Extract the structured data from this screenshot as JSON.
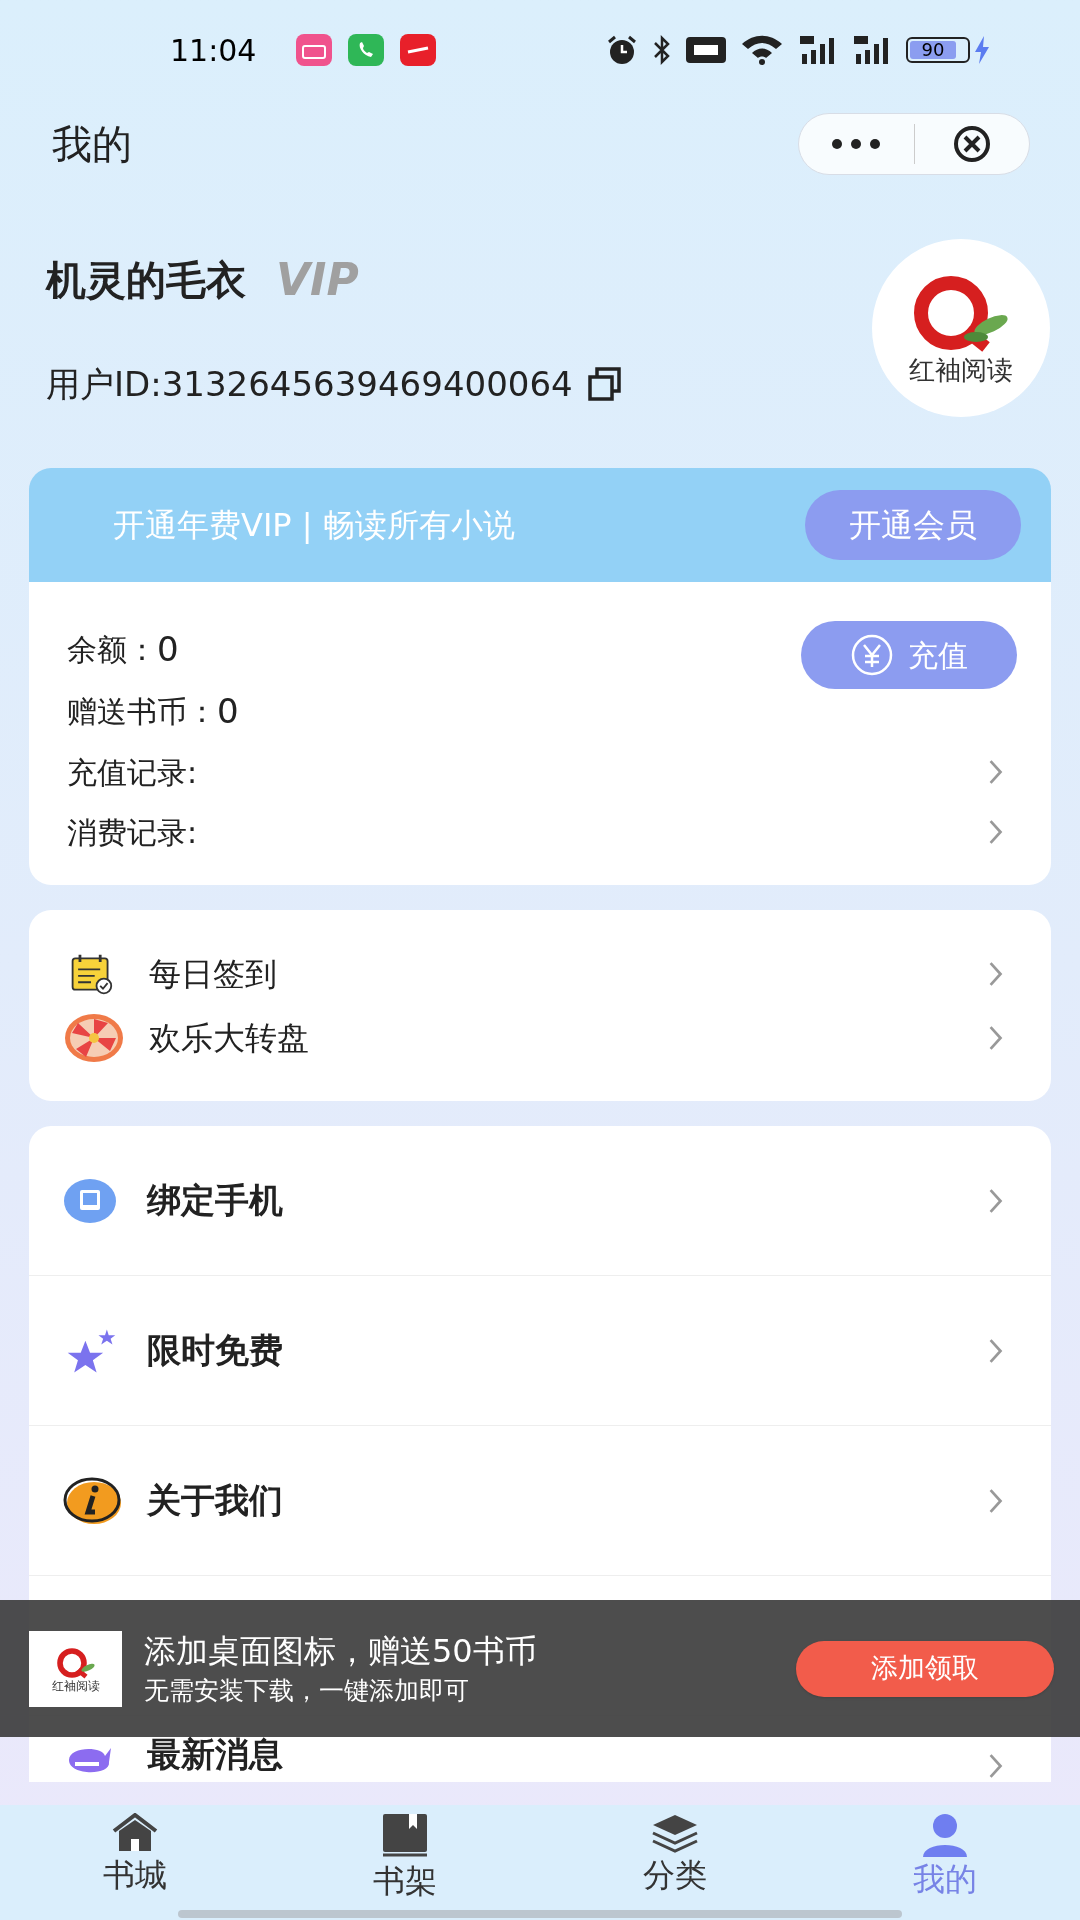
{
  "status_bar": {
    "time": "11:04",
    "battery": "90"
  },
  "header": {
    "title": "我的"
  },
  "profile": {
    "name": "机灵的毛衣",
    "vip_badge": "VIP",
    "user_id": "用户ID:3132645639469400064",
    "logo_text": "红袖阅读"
  },
  "vip_banner": {
    "text": "开通年费VIP | 畅读所有小说",
    "button": "开通会员"
  },
  "wallet": {
    "rows": [
      {
        "label": "余额：",
        "value": "0"
      },
      {
        "label": "赠送书币：",
        "value": "0"
      }
    ],
    "button": "充值",
    "records": [
      "充值记录:",
      "消费记录:"
    ]
  },
  "activities": [
    {
      "kind": "calendar",
      "label": "每日签到"
    },
    {
      "kind": "wheel",
      "label": "欢乐大转盘"
    }
  ],
  "menu": [
    {
      "kind": "phone",
      "label": "绑定手机"
    },
    {
      "kind": "star",
      "label": "限时免费"
    },
    {
      "kind": "info",
      "label": "关于我们"
    },
    {
      "kind": "new",
      "label": "最新消息"
    }
  ],
  "promo": {
    "logo_text": "红袖阅读",
    "title": "添加桌面图标，赠送50书币",
    "subtitle": "无需安装下载，一键添加即可",
    "button": "添加领取"
  },
  "tabs": [
    {
      "kind": "home",
      "label": "书城",
      "selected": false
    },
    {
      "kind": "shelf",
      "label": "书架",
      "selected": false
    },
    {
      "kind": "category",
      "label": "分类",
      "selected": false
    },
    {
      "kind": "me",
      "label": "我的",
      "selected": true
    }
  ]
}
